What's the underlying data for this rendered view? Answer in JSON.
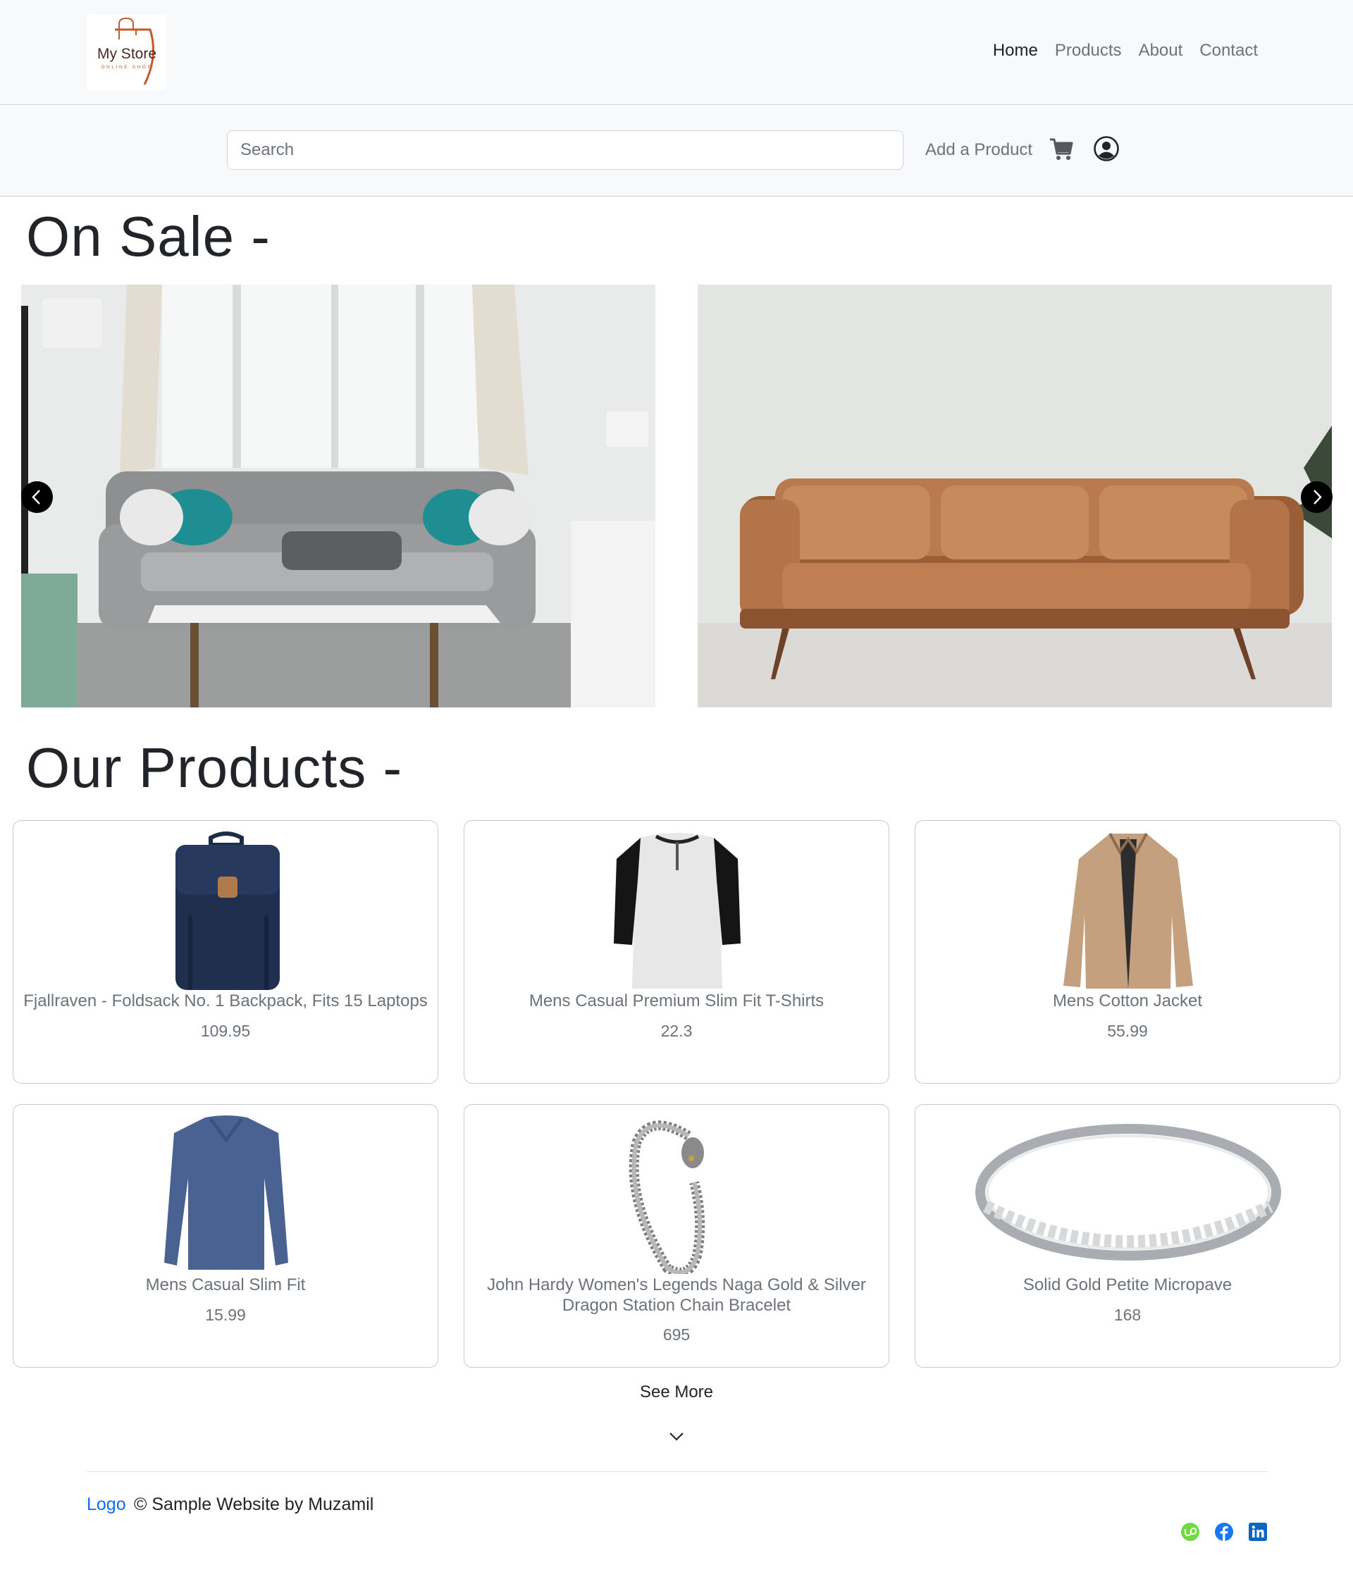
{
  "brand": {
    "name": "My Store",
    "tagline": "ONLINE SHOP"
  },
  "nav": {
    "links": [
      {
        "label": "Home",
        "active": true
      },
      {
        "label": "Products",
        "active": false
      },
      {
        "label": "About",
        "active": false
      },
      {
        "label": "Contact",
        "active": false
      }
    ]
  },
  "toolbar": {
    "search_placeholder": "Search",
    "search_value": "",
    "add_product_label": "Add a Product",
    "cart_icon": "shopping-cart-icon",
    "user_icon": "user-circle-icon"
  },
  "sale": {
    "title": "On Sale -",
    "slides": [
      {
        "image": "grey-tufted-sofa-living-room"
      },
      {
        "image": "tan-leather-sofa"
      }
    ],
    "prev_icon": "chevron-left-icon",
    "next_icon": "chevron-right-icon"
  },
  "products": {
    "title": "Our Products -",
    "items": [
      {
        "name": "Fjallraven - Foldsack No. 1 Backpack, Fits 15 Laptops",
        "price": "109.95",
        "image": "navy-backpack"
      },
      {
        "name": "Mens Casual Premium Slim Fit T-Shirts",
        "price": "22.3",
        "image": "raglan-henley-tshirt"
      },
      {
        "name": "Mens Cotton Jacket",
        "price": "55.99",
        "image": "khaki-jacket"
      },
      {
        "name": "Mens Casual Slim Fit",
        "price": "15.99",
        "image": "blue-long-sleeve-tee"
      },
      {
        "name": "John Hardy Women's Legends Naga Gold & Silver Dragon Station Chain Bracelet",
        "price": "695",
        "image": "dragon-chain-bracelet"
      },
      {
        "name": "Solid Gold Petite Micropave",
        "price": "168",
        "image": "silver-micropave-ring"
      }
    ],
    "see_more_label": "See More"
  },
  "footer": {
    "logo_label": "Logo",
    "copyright": "© Sample Website by Muzamil",
    "social": [
      "upwork-icon",
      "facebook-icon",
      "linkedin-icon"
    ]
  },
  "colors": {
    "navbar_bg": "#f8f9fa",
    "link_blue": "#0d6efd",
    "muted_text": "#6c737a",
    "upwork_green": "#6fda44",
    "facebook_blue": "#1877f2",
    "linkedin_blue": "#0a66c2"
  }
}
